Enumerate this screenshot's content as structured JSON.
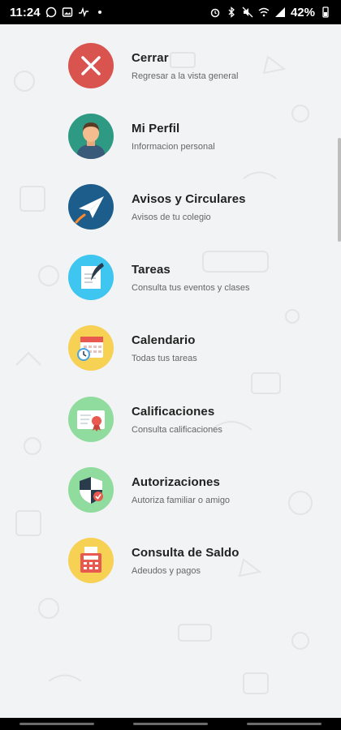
{
  "status_bar": {
    "time": "11:24",
    "battery": "42%"
  },
  "menu": {
    "items": [
      {
        "title": "Cerrar",
        "subtitle": "Regresar a la vista general",
        "icon": "close-icon",
        "color": "#d9534f"
      },
      {
        "title": "Mi Perfil",
        "subtitle": "Informacion personal",
        "icon": "profile-icon",
        "color": "#2f9a83"
      },
      {
        "title": "Avisos y Circulares",
        "subtitle": "Avisos de tu colegio",
        "icon": "paper-plane-icon",
        "color": "#1c5d8c"
      },
      {
        "title": "Tareas",
        "subtitle": "Consulta tus eventos y clases",
        "icon": "quill-paper-icon",
        "color": "#3ec6f0"
      },
      {
        "title": "Calendario",
        "subtitle": "Todas tus tareas",
        "icon": "calendar-clock-icon",
        "color": "#f7d154"
      },
      {
        "title": "Calificaciones",
        "subtitle": "Consulta calificaciones",
        "icon": "certificate-icon",
        "color": "#8fdc9e"
      },
      {
        "title": "Autorizaciones",
        "subtitle": "Autoriza familiar o amigo",
        "icon": "shield-check-icon",
        "color": "#8fdc9e"
      },
      {
        "title": "Consulta de Saldo",
        "subtitle": "Adeudos y pagos",
        "icon": "cash-register-icon",
        "color": "#f7d154"
      }
    ]
  }
}
